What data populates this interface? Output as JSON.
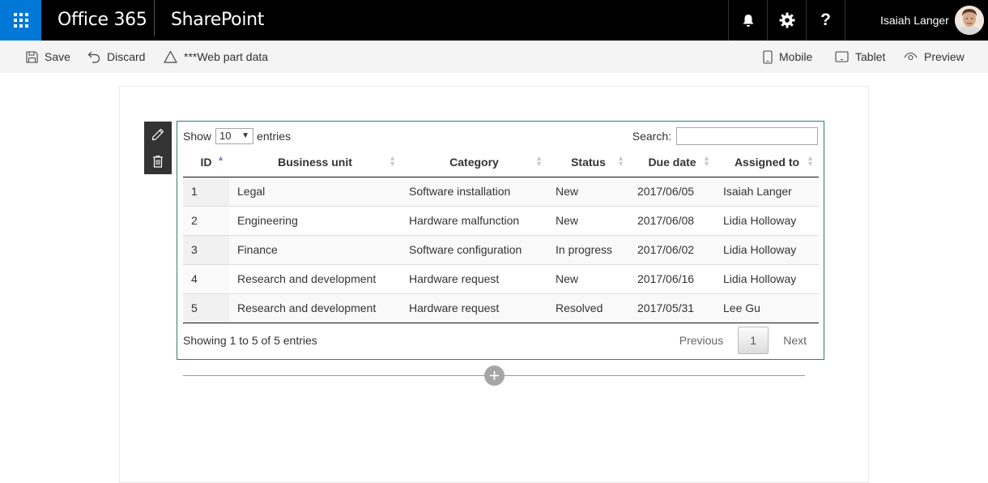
{
  "suitebar": {
    "brand": "Office 365",
    "app_name": "SharePoint",
    "help_label": "?",
    "user_name": "Isaiah Langer"
  },
  "commandbar": {
    "save": "Save",
    "discard": "Discard",
    "webpart_data": "***Web part data",
    "mobile": "Mobile",
    "tablet": "Tablet",
    "preview": "Preview"
  },
  "table_controls": {
    "show_label": "Show",
    "entries_value": "10",
    "entries_label": "entries",
    "search_label": "Search:",
    "search_value": ""
  },
  "table": {
    "columns": [
      "ID",
      "Business unit",
      "Category",
      "Status",
      "Due date",
      "Assigned to"
    ],
    "rows": [
      [
        "1",
        "Legal",
        "Software installation",
        "New",
        "2017/06/05",
        "Isaiah Langer"
      ],
      [
        "2",
        "Engineering",
        "Hardware malfunction",
        "New",
        "2017/06/08",
        "Lidia Holloway"
      ],
      [
        "3",
        "Finance",
        "Software configuration",
        "In progress",
        "2017/06/02",
        "Lidia Holloway"
      ],
      [
        "4",
        "Research and development",
        "Hardware request",
        "New",
        "2017/06/16",
        "Lidia Holloway"
      ],
      [
        "5",
        "Research and development",
        "Hardware request",
        "Resolved",
        "2017/05/31",
        "Lee Gu"
      ]
    ]
  },
  "footer": {
    "info": "Showing 1 to 5 of 5 entries",
    "previous": "Previous",
    "current_page": "1",
    "next": "Next"
  },
  "colors": {
    "waffle_bg": "#0078d7",
    "suitebar_bg": "#000000",
    "webpart_border": "#2e7d75",
    "sort_active": "#7a86c7"
  },
  "icons": [
    "waffle-icon",
    "bell-icon",
    "gear-icon",
    "help-icon",
    "save-icon",
    "undo-icon",
    "warning-icon",
    "mobile-icon",
    "tablet-icon",
    "eye-icon",
    "pencil-icon",
    "trash-icon",
    "plus-icon"
  ]
}
